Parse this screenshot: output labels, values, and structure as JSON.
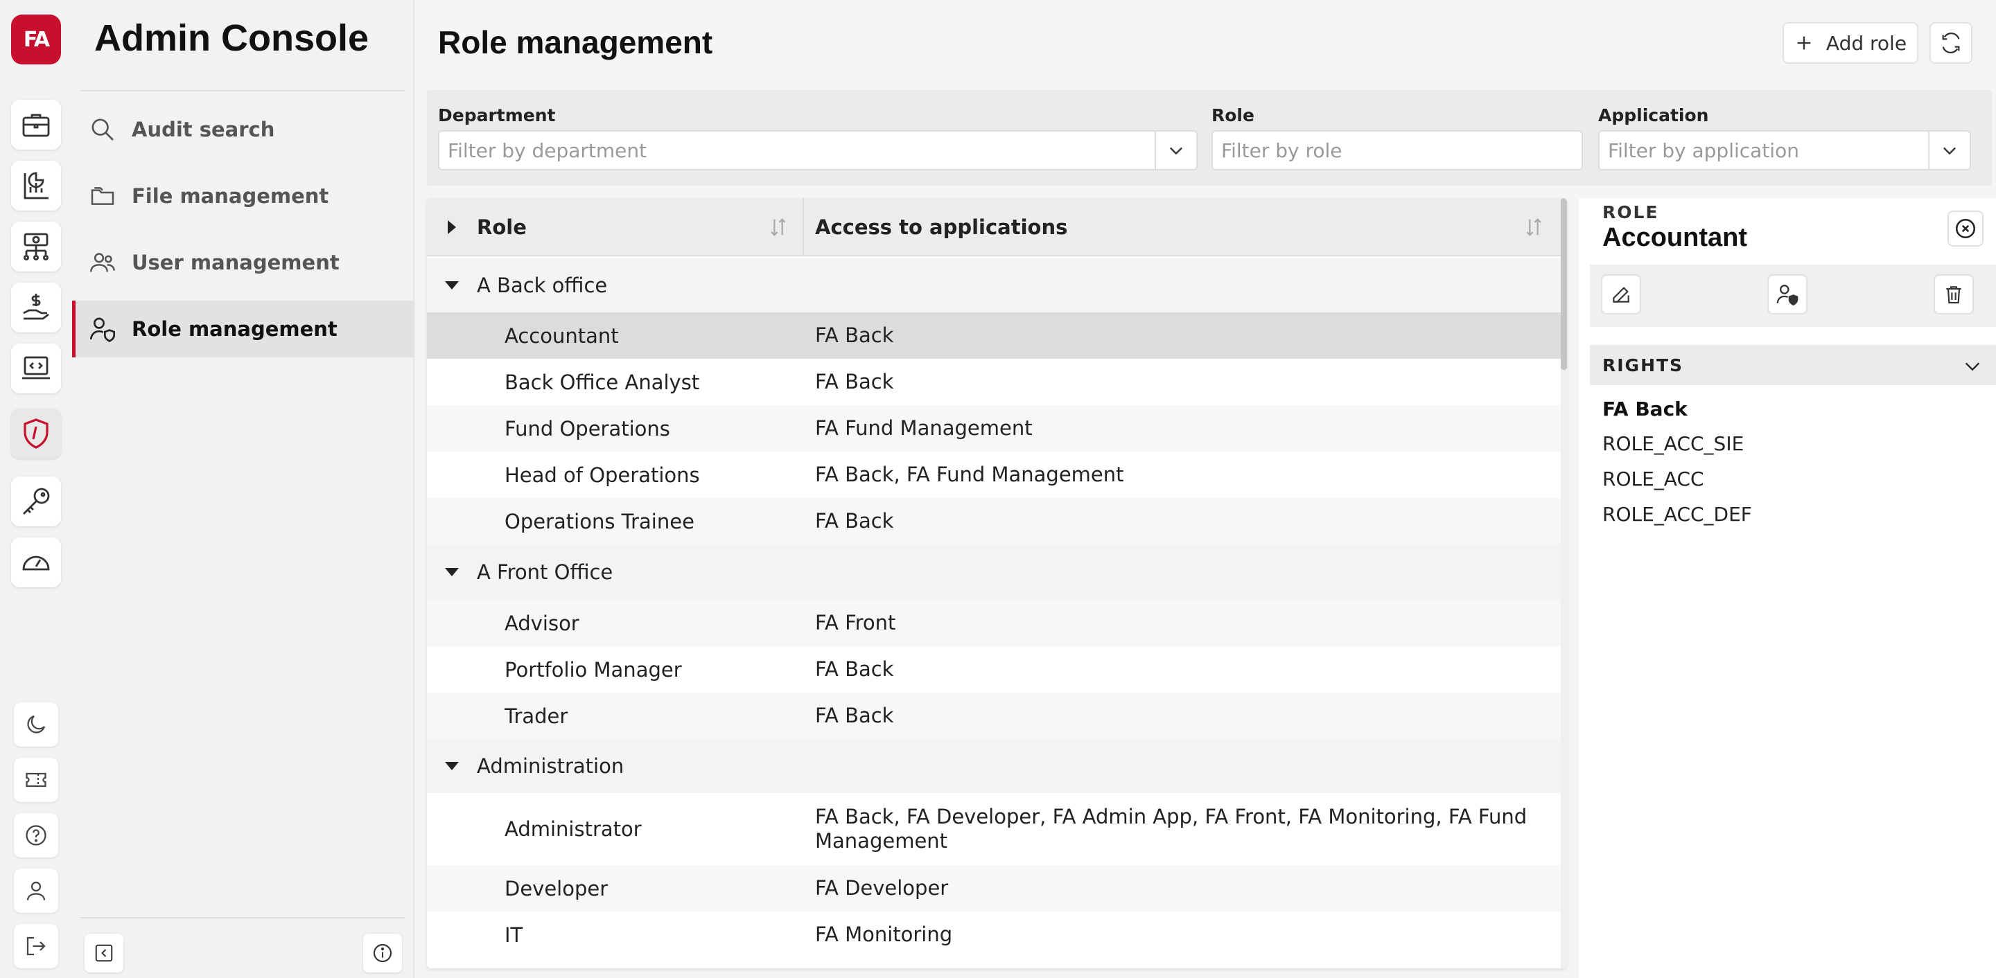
{
  "app": {
    "logo_text": "FA",
    "title": "Admin Console"
  },
  "rail": {
    "items": [
      {
        "icon": "briefcase-icon"
      },
      {
        "icon": "reports-icon"
      },
      {
        "icon": "money-tree-icon"
      },
      {
        "icon": "hand-dollar-icon"
      },
      {
        "icon": "laptop-code-icon"
      },
      {
        "icon": "shield-icon",
        "active": true
      },
      {
        "icon": "key-icon"
      },
      {
        "icon": "gauge-icon"
      }
    ],
    "bottom": [
      "moon-icon",
      "ticket-icon",
      "help-icon",
      "user-icon",
      "logout-icon"
    ]
  },
  "nav": {
    "items": [
      {
        "label": "Audit search",
        "icon": "search-icon"
      },
      {
        "label": "File management",
        "icon": "folder-icon"
      },
      {
        "label": "User management",
        "icon": "users-icon"
      },
      {
        "label": "Role management",
        "icon": "user-shield-icon",
        "active": true
      }
    ]
  },
  "page": {
    "title": "Role management"
  },
  "toolbar": {
    "add_label": "Add role"
  },
  "filters": {
    "department": {
      "label": "Department",
      "placeholder": "Filter by department"
    },
    "role": {
      "label": "Role",
      "placeholder": "Filter by role"
    },
    "application": {
      "label": "Application",
      "placeholder": "Filter by application"
    }
  },
  "table": {
    "columns": [
      "Role",
      "Access to applications"
    ],
    "groups": [
      {
        "name": "A Back office",
        "rows": [
          {
            "role": "Accountant",
            "apps": "FA Back",
            "selected": true
          },
          {
            "role": "Back Office Analyst",
            "apps": "FA Back"
          },
          {
            "role": "Fund Operations",
            "apps": "FA Fund Management"
          },
          {
            "role": "Head of Operations",
            "apps": "FA Back, FA Fund Management"
          },
          {
            "role": "Operations Trainee",
            "apps": "FA Back"
          }
        ]
      },
      {
        "name": "A Front Office",
        "rows": [
          {
            "role": "Advisor",
            "apps": "FA Front"
          },
          {
            "role": "Portfolio Manager",
            "apps": "FA Back"
          },
          {
            "role": "Trader",
            "apps": "FA Back"
          }
        ]
      },
      {
        "name": "Administration",
        "rows": [
          {
            "role": "Administrator",
            "apps": "FA Back, FA Developer, FA Admin App, FA Front, FA Monitoring, FA Fund Management"
          },
          {
            "role": "Developer",
            "apps": "FA Developer"
          },
          {
            "role": "IT",
            "apps": "FA Monitoring"
          }
        ]
      }
    ]
  },
  "detail": {
    "kicker": "ROLE",
    "name": "Accountant",
    "rights_label": "RIGHTS",
    "rights": [
      {
        "application": "FA Back",
        "items": [
          "ROLE_ACC_SIE",
          "ROLE_ACC",
          "ROLE_ACC_DEF"
        ]
      }
    ]
  },
  "colors": {
    "brand": "#c8102e",
    "selected_row": "#dcdcdc"
  }
}
